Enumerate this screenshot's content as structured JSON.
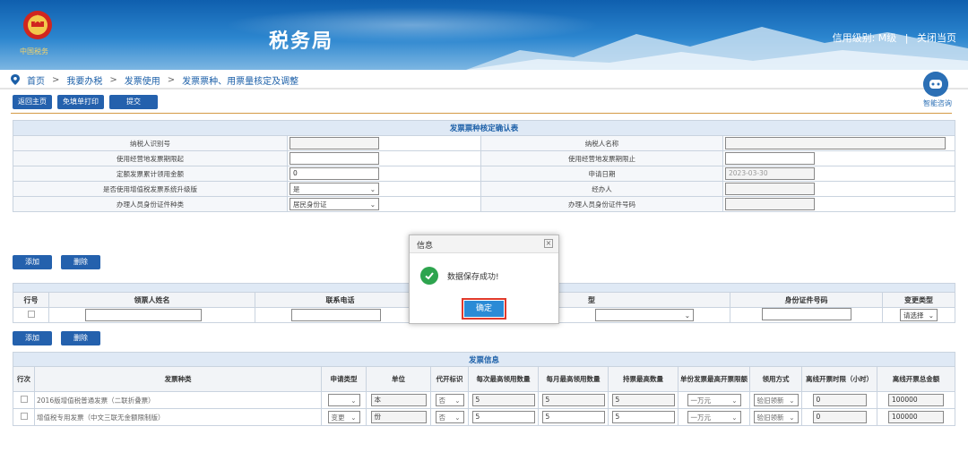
{
  "header": {
    "emblem_caption": "中国税务",
    "site_title": "税务局",
    "credit_label": "信用级别: M级",
    "separator": "|",
    "close_label": "关闭当页"
  },
  "breadcrumb": {
    "items": [
      "首页",
      "我要办税",
      "发票使用",
      "发票票种、用票量核定及调整"
    ],
    "sep": ">"
  },
  "assistant": {
    "label": "智能咨询"
  },
  "toolbar": {
    "back": "返回主页",
    "print": "免填单打印",
    "submit": "提交"
  },
  "form": {
    "caption": "发票票种核定确认表",
    "rows": [
      {
        "l1": "纳税人识别号",
        "v1": "",
        "l2": "纳税人名称",
        "v2": ""
      },
      {
        "l1": "使用经营地发票期限起",
        "v1": "",
        "l2": "使用经营地发票期限止",
        "v2": ""
      },
      {
        "l1": "定额发票累计领用金额",
        "v1": "0",
        "l2": "申请日期",
        "v2": "2023-03-30"
      },
      {
        "l1": "是否使用增值税发票系统升级版",
        "v1": "是",
        "l2": "经办人",
        "v2": ""
      },
      {
        "l1": "办理人员身份证件种类",
        "v1": "居民身份证",
        "l2": "办理人员身份证件号码",
        "v2": ""
      }
    ]
  },
  "holders": {
    "add": "添加",
    "delete": "删除",
    "headers": [
      "行号",
      "领票人姓名",
      "联系电话",
      "型",
      "身份证件号码",
      "变更类型"
    ],
    "row": {
      "change_type": "请选择"
    }
  },
  "invoices": {
    "add": "添加",
    "delete": "删除",
    "caption": "发票信息",
    "headers": [
      "行次",
      "发票种类",
      "申请类型",
      "单位",
      "代开标识",
      "每次最高领用数量",
      "每月最高领用数量",
      "持票最高数量",
      "单份发票最高开票限额",
      "领用方式",
      "离线开票时限（小时）",
      "离线开票总金额"
    ],
    "rows": [
      {
        "kind": "2016版增值税普通发票（二联折叠票）",
        "apply": "",
        "unit": "本",
        "agent": "否",
        "per": "5",
        "month": "5",
        "hold": "5",
        "limit": "一万元",
        "method": "验旧领新",
        "offline_h": "0",
        "offline_amt": "100000"
      },
      {
        "kind": "增值税专用发票（中文三联无金额限制版）",
        "apply": "变更",
        "unit": "份",
        "agent": "否",
        "per": "5",
        "month": "5",
        "hold": "5",
        "limit": "一万元",
        "method": "验旧领新",
        "offline_h": "0",
        "offline_amt": "100000"
      }
    ]
  },
  "modal": {
    "title": "信息",
    "close": "×",
    "message": "数据保存成功!",
    "ok": "确定"
  }
}
